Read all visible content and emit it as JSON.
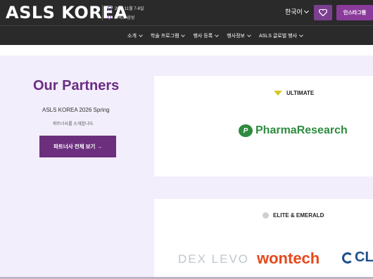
{
  "header": {
    "logo_text": "ASLS KOREA",
    "event_date": "26년 11월 7-8일",
    "event_venue": "코엑스 삼성",
    "language_label": "한국어",
    "heart_icon": "heart-icon",
    "instagram_label": "인스타그램"
  },
  "nav": {
    "items": [
      {
        "label": "소개"
      },
      {
        "label": "학술 프로그램"
      },
      {
        "label": "행사 등록"
      },
      {
        "label": "행사정보"
      },
      {
        "label": "ASLS 글로벌 행사"
      }
    ]
  },
  "partners": {
    "title": "Our Partners",
    "subtitle": "ASLS KOREA 2026 Spring",
    "description": "파트너사를 소개합니다.",
    "view_all_label": "파트너사 전체 보기 →"
  },
  "tiers": {
    "ultimate": {
      "label": "ULTIMATE",
      "logo_text": "PharmaResearch"
    },
    "elite": {
      "label": "ELITE & EMERALD",
      "logos": [
        "DEX LEVO",
        "wontech",
        "CL"
      ]
    }
  },
  "colors": {
    "brand_purple": "#6c2f7e",
    "header_bg": "#2a2a2a",
    "page_bg": "#f3eefb"
  }
}
